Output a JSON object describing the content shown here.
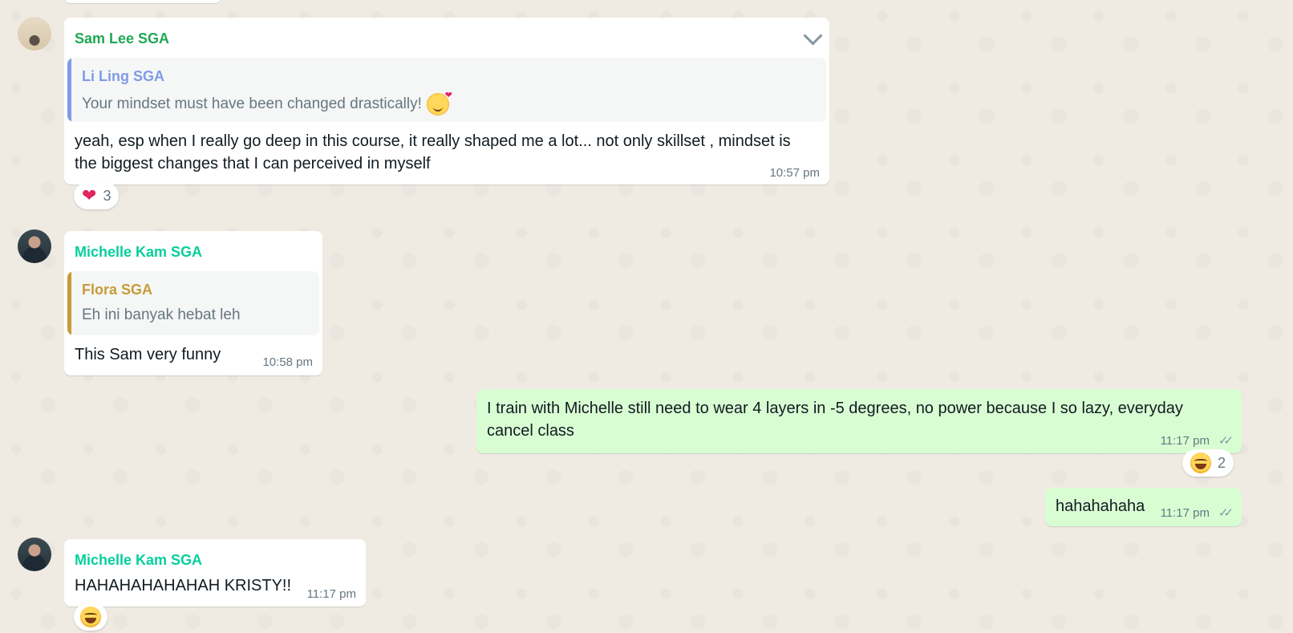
{
  "colors": {
    "chat_bg": "#efeae2",
    "incoming_bubble": "#ffffff",
    "outgoing_bubble": "#d9fdd3",
    "sender_sam": "#1fa855",
    "sender_michelle": "#06cf9c",
    "quote_li_ling": "#7f9be8",
    "quote_flora": "#c79b36",
    "meta_text": "#667781"
  },
  "messages": {
    "m1": {
      "sender": "Sam Lee SGA",
      "quote_author": "Li Ling SGA",
      "quote_text": "Your mindset must have been changed drastically!",
      "quote_emoji": "smiling-face-with-hearts",
      "text": "yeah, esp when I really go deep in this course, it really shaped me a lot... not only skillset , mindset is the biggest changes that I can perceived in myself",
      "time": "10:57 pm",
      "reaction_emoji": "red-heart",
      "reaction_count": "3"
    },
    "m2": {
      "sender": "Michelle Kam SGA",
      "quote_author": "Flora SGA",
      "quote_text": "Eh ini banyak hebat leh",
      "text": "This Sam very funny",
      "time": "10:58 pm"
    },
    "m3": {
      "text": "I train with Michelle still need to wear 4 layers in -5 degrees, no power because I so lazy, everyday cancel class",
      "time": "11:17 pm",
      "status": "read",
      "reaction_emoji": "face-with-tears-of-joy",
      "reaction_count": "2"
    },
    "m4": {
      "text": "hahahahaha",
      "time": "11:17 pm",
      "status": "read"
    },
    "m5": {
      "sender": "Michelle Kam SGA",
      "text": "HAHAHAHAHAHAH KRISTY!!",
      "time": "11:17 pm",
      "reaction_emoji": "face-with-tears-of-joy"
    }
  }
}
